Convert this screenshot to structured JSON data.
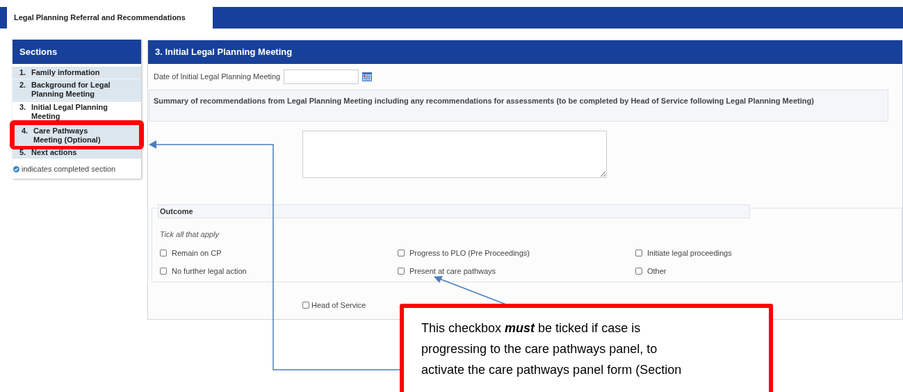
{
  "tab": {
    "label": "Legal Planning Referral and Recommendations"
  },
  "sidebar": {
    "title": "Sections",
    "items": [
      {
        "number": "1.",
        "label": "Family information",
        "selected": false,
        "highlighted": false
      },
      {
        "number": "2.",
        "label": "Background for Legal Planning Meeting",
        "selected": false,
        "highlighted": false
      },
      {
        "number": "3.",
        "label": "Initial Legal Planning Meeting",
        "selected": true,
        "highlighted": false
      },
      {
        "number": "4.",
        "label": "Care Pathways Meeting (Optional)",
        "selected": false,
        "highlighted": true
      },
      {
        "number": "5.",
        "label": "Next actions",
        "selected": false,
        "highlighted": false
      }
    ],
    "legend": "indicates completed section"
  },
  "panel": {
    "title": "3. Initial Legal Planning Meeting",
    "date_label": "Date of Initial Legal Planning Meeting",
    "summary_label": "Summary of recommendations from Legal Planning Meeting including any recommendations for assessments (to be completed by Head of Service following Legal Planning Meeting)",
    "outcome": {
      "title": "Outcome",
      "hint": "Tick all that apply",
      "options": [
        {
          "label": "Remain on CP",
          "checked": false
        },
        {
          "label": "Progress to PLO (Pre Proceedings)",
          "checked": false
        },
        {
          "label": "Initiate legal proceedings",
          "checked": false
        },
        {
          "label": "No further legal action",
          "checked": false
        },
        {
          "label": "Present at care pathways",
          "checked": false
        },
        {
          "label": "Other",
          "checked": false
        }
      ]
    },
    "head_of_service": {
      "label": "Head of Service",
      "checked": false
    }
  },
  "callout": {
    "text": "This checkbox **must** be ticked if case is progressing to the care pathways panel, to activate the care pathways panel form (Section"
  }
}
